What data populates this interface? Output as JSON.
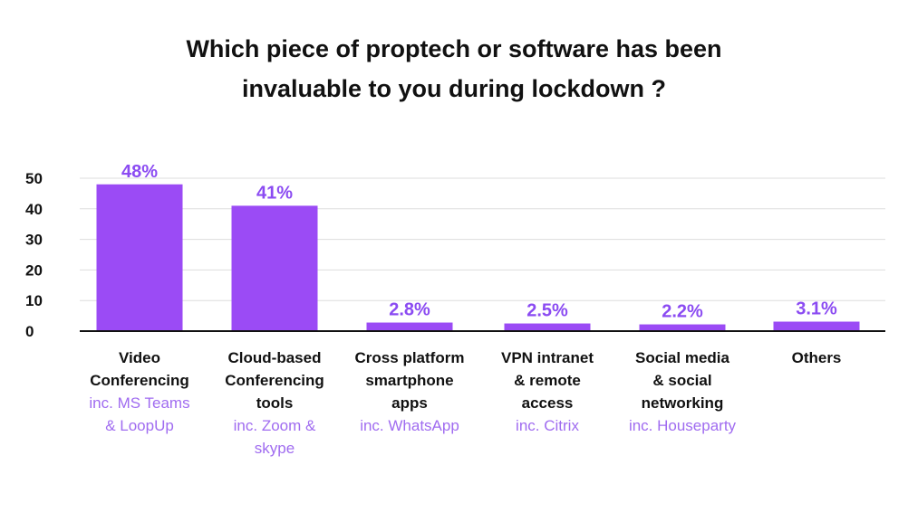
{
  "title": {
    "line1": "Which piece of proptech or software has been",
    "line2": "invaluable to you during lockdown ?"
  },
  "colors": {
    "bar": "#9b4bf5",
    "label": "#8b4bf2",
    "subtext": "#a06cf0",
    "grid": "#dddddd",
    "axis": "#111111"
  },
  "chart_data": {
    "type": "bar",
    "title": "Which piece of proptech or software has been invaluable to you during lockdown ?",
    "categories": [
      {
        "lines": [
          "Video",
          "Conferencing"
        ],
        "sub": [
          "inc. MS Teams",
          "& LoopUp"
        ]
      },
      {
        "lines": [
          "Cloud-based",
          "Conferencing",
          "tools"
        ],
        "sub": [
          "inc. Zoom &",
          "skype"
        ]
      },
      {
        "lines": [
          "Cross platform",
          "smartphone",
          "apps"
        ],
        "sub": [
          "inc. WhatsApp"
        ]
      },
      {
        "lines": [
          "VPN intranet",
          "& remote",
          "access"
        ],
        "sub": [
          "inc. Citrix"
        ]
      },
      {
        "lines": [
          "Social media",
          "& social",
          "networking"
        ],
        "sub": [
          "inc. Houseparty"
        ]
      },
      {
        "lines": [
          "Others"
        ],
        "sub": []
      }
    ],
    "values": [
      48,
      41,
      2.8,
      2.5,
      2.2,
      3.1
    ],
    "data_labels": [
      "48%",
      "41%",
      "2.8%",
      "2.5%",
      "2.2%",
      "3.1%"
    ],
    "yticks": [
      "0",
      "10",
      "20",
      "30",
      "40",
      "50"
    ],
    "ylim": [
      0,
      50
    ],
    "grid": true
  }
}
